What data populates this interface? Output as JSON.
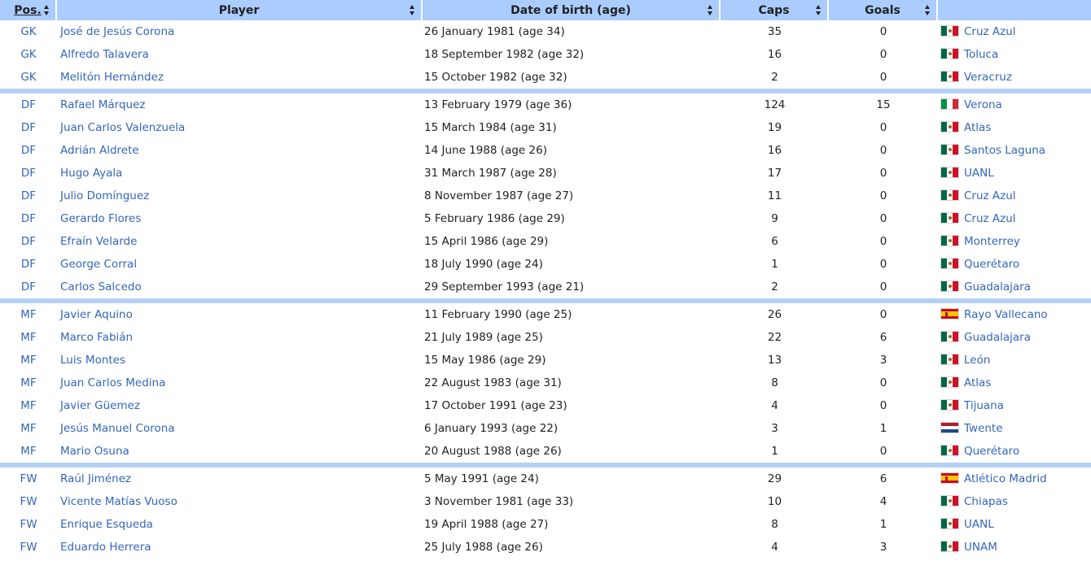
{
  "headers": {
    "pos": "Pos.",
    "player": "Player",
    "dob": "Date of birth (age)",
    "caps": "Caps",
    "goals": "Goals",
    "club": ""
  },
  "rows": [
    {
      "pos": "GK",
      "player": "José de Jesús Corona",
      "dob": "26 January 1981 (age 34)",
      "caps": "35",
      "goals": "0",
      "club": "Cruz Azul",
      "flag": "mexico-flag-icon"
    },
    {
      "pos": "GK",
      "player": "Alfredo Talavera",
      "dob": "18 September 1982 (age 32)",
      "caps": "16",
      "goals": "0",
      "club": "Toluca",
      "flag": "mexico-flag-icon"
    },
    {
      "pos": "GK",
      "player": "Melitón Hernández",
      "dob": "15 October 1982 (age 32)",
      "caps": "2",
      "goals": "0",
      "club": "Veracruz",
      "flag": "mexico-flag-icon"
    },
    {
      "pos": "DF",
      "player": "Rafael Márquez",
      "dob": "13 February 1979 (age 36)",
      "caps": "124",
      "goals": "15",
      "club": "Verona",
      "flag": "italy-flag-icon"
    },
    {
      "pos": "DF",
      "player": "Juan Carlos Valenzuela",
      "dob": "15 March 1984 (age 31)",
      "caps": "19",
      "goals": "0",
      "club": "Atlas",
      "flag": "mexico-flag-icon"
    },
    {
      "pos": "DF",
      "player": "Adrián Aldrete",
      "dob": "14 June 1988 (age 26)",
      "caps": "16",
      "goals": "0",
      "club": "Santos Laguna",
      "flag": "mexico-flag-icon"
    },
    {
      "pos": "DF",
      "player": "Hugo Ayala",
      "dob": "31 March 1987 (age 28)",
      "caps": "17",
      "goals": "0",
      "club": "UANL",
      "flag": "mexico-flag-icon"
    },
    {
      "pos": "DF",
      "player": "Julio Domínguez",
      "dob": "8 November 1987 (age 27)",
      "caps": "11",
      "goals": "0",
      "club": "Cruz Azul",
      "flag": "mexico-flag-icon"
    },
    {
      "pos": "DF",
      "player": "Gerardo Flores",
      "dob": "5 February 1986 (age 29)",
      "caps": "9",
      "goals": "0",
      "club": "Cruz Azul",
      "flag": "mexico-flag-icon"
    },
    {
      "pos": "DF",
      "player": "Efraín Velarde",
      "dob": "15 April 1986 (age 29)",
      "caps": "6",
      "goals": "0",
      "club": "Monterrey",
      "flag": "mexico-flag-icon"
    },
    {
      "pos": "DF",
      "player": "George Corral",
      "dob": "18 July 1990 (age 24)",
      "caps": "1",
      "goals": "0",
      "club": "Querétaro",
      "flag": "mexico-flag-icon"
    },
    {
      "pos": "DF",
      "player": "Carlos Salcedo",
      "dob": "29 September 1993 (age 21)",
      "caps": "2",
      "goals": "0",
      "club": "Guadalajara",
      "flag": "mexico-flag-icon"
    },
    {
      "pos": "MF",
      "player": "Javier Aquino",
      "dob": "11 February 1990 (age 25)",
      "caps": "26",
      "goals": "0",
      "club": "Rayo Vallecano",
      "flag": "spain-flag-icon"
    },
    {
      "pos": "MF",
      "player": "Marco Fabián",
      "dob": "21 July 1989 (age 25)",
      "caps": "22",
      "goals": "6",
      "club": "Guadalajara",
      "flag": "mexico-flag-icon"
    },
    {
      "pos": "MF",
      "player": "Luis Montes",
      "dob": "15 May 1986 (age 29)",
      "caps": "13",
      "goals": "3",
      "club": "León",
      "flag": "mexico-flag-icon"
    },
    {
      "pos": "MF",
      "player": "Juan Carlos Medina",
      "dob": "22 August 1983 (age 31)",
      "caps": "8",
      "goals": "0",
      "club": "Atlas",
      "flag": "mexico-flag-icon"
    },
    {
      "pos": "MF",
      "player": "Javier Güemez",
      "dob": "17 October 1991 (age 23)",
      "caps": "4",
      "goals": "0",
      "club": "Tijuana",
      "flag": "mexico-flag-icon"
    },
    {
      "pos": "MF",
      "player": "Jesús Manuel Corona",
      "dob": "6 January 1993 (age 22)",
      "caps": "3",
      "goals": "1",
      "club": "Twente",
      "flag": "netherlands-flag-icon"
    },
    {
      "pos": "MF",
      "player": "Mario Osuna",
      "dob": "20 August 1988 (age 26)",
      "caps": "1",
      "goals": "0",
      "club": "Querétaro",
      "flag": "mexico-flag-icon"
    },
    {
      "pos": "FW",
      "player": "Raúl Jiménez",
      "dob": "5 May 1991 (age 24)",
      "caps": "29",
      "goals": "6",
      "club": "Atlético Madrid",
      "flag": "spain-flag-icon"
    },
    {
      "pos": "FW",
      "player": "Vicente Matías Vuoso",
      "dob": "3 November 1981 (age 33)",
      "caps": "10",
      "goals": "4",
      "club": "Chiapas",
      "flag": "mexico-flag-icon"
    },
    {
      "pos": "FW",
      "player": "Enrique Esqueda",
      "dob": "19 April 1988 (age 27)",
      "caps": "8",
      "goals": "1",
      "club": "UANL",
      "flag": "mexico-flag-icon"
    },
    {
      "pos": "FW",
      "player": "Eduardo Herrera",
      "dob": "25 July 1988 (age 26)",
      "caps": "4",
      "goals": "3",
      "club": "UNAM",
      "flag": "mexico-flag-icon"
    }
  ],
  "colors": {
    "header_bg": "#aaccff",
    "group_separator": "#b4d0f4",
    "link": "#3366bb",
    "text": "#222222"
  }
}
